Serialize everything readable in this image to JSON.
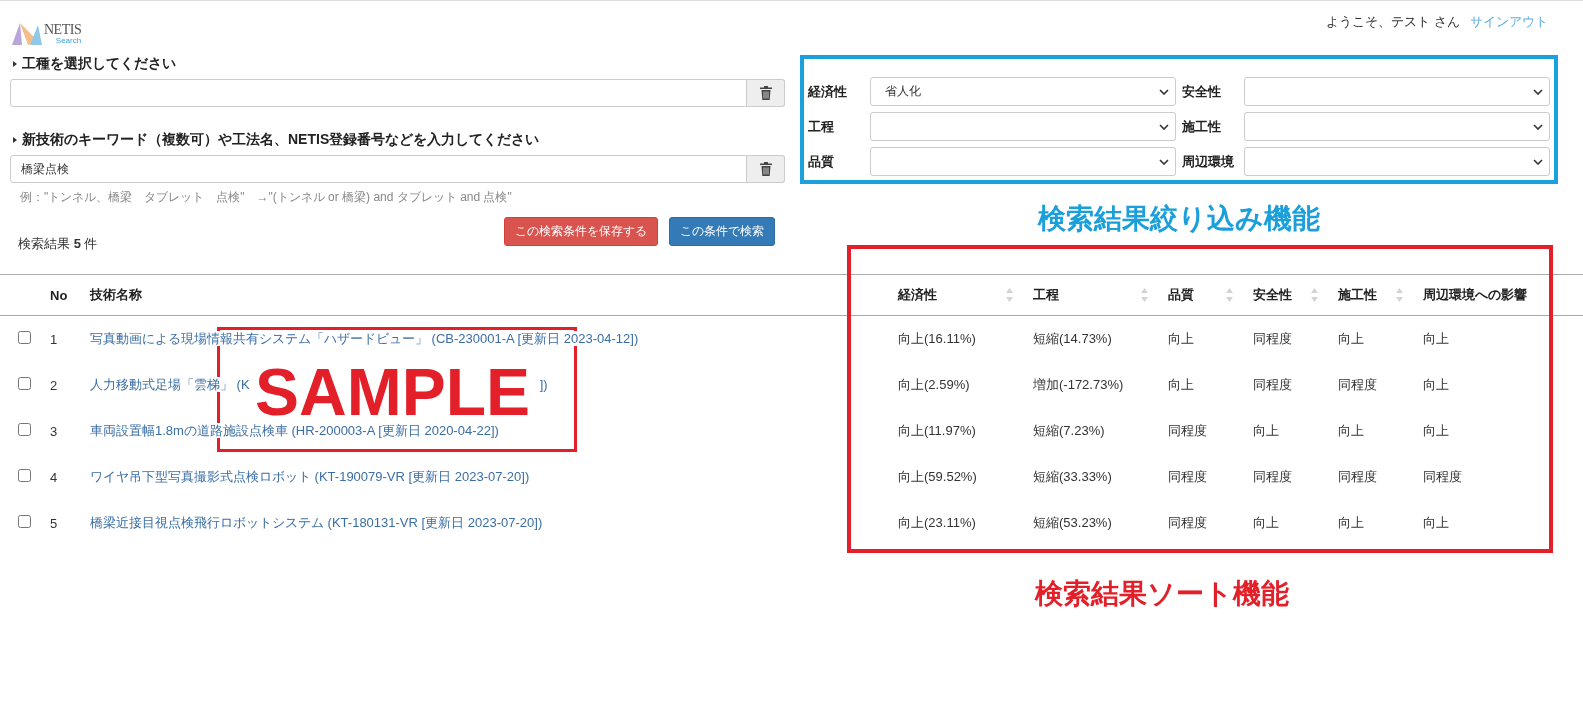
{
  "header": {
    "logo": {
      "name": "NETIS",
      "sub": "Search"
    },
    "greeting": "ようこそ、テスト さん",
    "signout": "サインアウト"
  },
  "search": {
    "category_label": "工種を選択してください",
    "keyword_label": "新技術のキーワード（複数可）や工法名、NETIS登録番号などを入力してください",
    "keyword_value": "橋梁点検",
    "example": "例：\"トンネル、橋梁　タブレット　点検\"　→\"(トンネル or 橋梁) and タブレット and 点検\"",
    "result_count": "検索結果 **5** 件",
    "save_button": "この検索条件を保存する",
    "search_button": "この条件で検索"
  },
  "filters": [
    {
      "label": "経済性",
      "value": "省人化"
    },
    {
      "label": "安全性"
    },
    {
      "label": "工程"
    },
    {
      "label": "施工性"
    },
    {
      "label": "品質"
    },
    {
      "label": "周辺環境"
    }
  ],
  "filter_caption": "検索結果絞り込み機能",
  "table": {
    "columns": [
      {
        "label": "No",
        "sortable": false
      },
      {
        "label": "技術名称",
        "sortable": false
      },
      {
        "label": "経済性",
        "sortable": true
      },
      {
        "label": "工程",
        "sortable": true
      },
      {
        "label": "品質",
        "sortable": true
      },
      {
        "label": "安全性",
        "sortable": true
      },
      {
        "label": "施工性",
        "sortable": true
      },
      {
        "label": "周辺環境への影響",
        "sortable": false
      }
    ],
    "rows": [
      {
        "checked": false,
        "no": "1",
        "title": "写真動画による現場情報共有システム「ハザードビュー」 (CB-230001-A [更新日 2023-04-12])",
        "values": [
          "向上(16.11%)",
          "短縮(14.73%)",
          "向上",
          "同程度",
          "向上",
          "向上"
        ]
      },
      {
        "checked": false,
        "no": "2",
        "title": "人力移動式足場「雲梯」 (K",
        "title_tail": "])",
        "values": [
          "向上(2.59%)",
          "増加(-172.73%)",
          "向上",
          "同程度",
          "同程度",
          "向上"
        ]
      },
      {
        "checked": false,
        "no": "3",
        "title": "車両設置幅1.8mの道路施設点検車 (HR-200003-A [更新日 2020-04-22])",
        "values": [
          "向上(11.97%)",
          "短縮(7.23%)",
          "同程度",
          "向上",
          "向上",
          "向上"
        ]
      },
      {
        "checked": false,
        "no": "4",
        "title": "ワイヤ吊下型写真撮影式点検ロボット (KT-190079-VR [更新日 2023-07-20])",
        "values": [
          "向上(59.52%)",
          "短縮(33.33%)",
          "同程度",
          "同程度",
          "同程度",
          "同程度"
        ]
      },
      {
        "checked": false,
        "no": "5",
        "title": "橋梁近接目視点検飛行ロボットシステム (KT-180131-VR [更新日 2023-07-20])",
        "values": [
          "向上(23.11%)",
          "短縮(53.23%)",
          "同程度",
          "向上",
          "向上",
          "向上"
        ]
      }
    ]
  },
  "sort_caption": "検索結果ソート機能",
  "stamp": "SAMPLE"
}
